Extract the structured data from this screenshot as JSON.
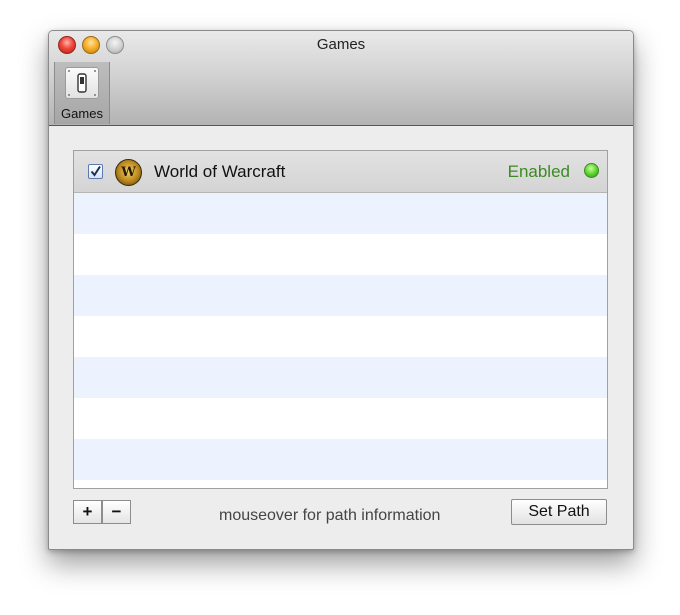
{
  "window": {
    "title": "Games",
    "traffic_lights": [
      "close",
      "minimize",
      "zoom"
    ]
  },
  "toolbar": {
    "items": [
      {
        "label": "Games",
        "icon": "switch-icon",
        "selected": true
      }
    ]
  },
  "games_list": {
    "rows": [
      {
        "checked": true,
        "icon": "warcraft-logo-icon",
        "icon_letter": "W",
        "name": "World of Warcraft",
        "status": "Enabled",
        "status_color": "#3b8b22",
        "status_indicator": "green"
      }
    ]
  },
  "footer": {
    "add_label": "+",
    "remove_label": "−",
    "hint": "mouseover for path information",
    "set_path_label": "Set Path"
  },
  "colors": {
    "alt_row": "#edf3fe",
    "enabled_green": "#3b8b22"
  }
}
